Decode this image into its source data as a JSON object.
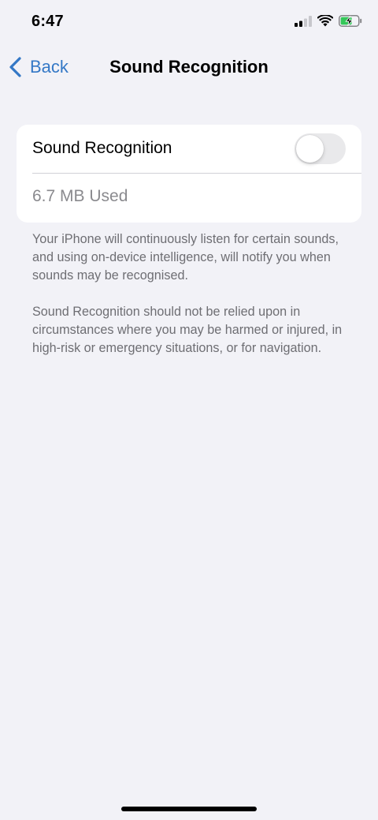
{
  "status_bar": {
    "time": "6:47",
    "icons": [
      "cellular-signal-icon",
      "wifi-icon",
      "battery-charging-icon"
    ],
    "battery_color": "#34c759"
  },
  "nav": {
    "back_label": "Back",
    "title": "Sound Recognition",
    "accent_color": "#3478c6"
  },
  "settings": {
    "toggle_label": "Sound Recognition",
    "toggle_on": false,
    "storage_used": "6.7 MB Used"
  },
  "footer": {
    "paragraph_1": "Your iPhone will continuously listen for certain sounds, and using on-device intelligence, will notify you when sounds may be recognised.",
    "paragraph_2": "Sound Recognition should not be relied upon in circumstances where you may be harmed or injured, in high-risk or emergency situations, or for navigation."
  }
}
